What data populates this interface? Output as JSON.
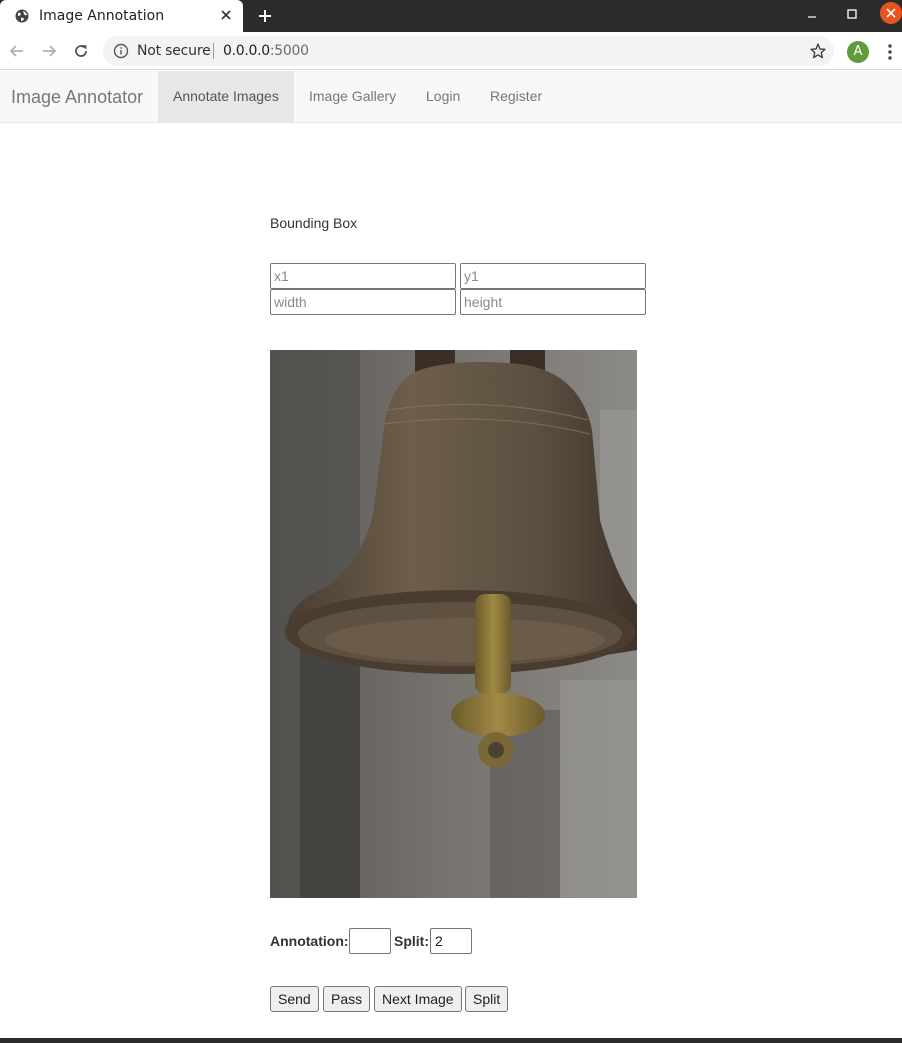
{
  "browser": {
    "tab_title": "Image Annotation",
    "security_label": "Not secure",
    "url_host": "0.0.0.0",
    "url_port": ":5000",
    "avatar_letter": "A",
    "icons": {
      "favicon": "globe-icon",
      "tab_close": "close-icon",
      "new_tab": "plus-icon",
      "back": "arrow-left-icon",
      "forward": "arrow-right-icon",
      "reload": "reload-icon",
      "info": "info-icon",
      "bookmark": "star-icon",
      "menu": "kebab-menu-icon"
    },
    "colors": {
      "titlebar": "#2b2b2b",
      "close_button": "#e95420",
      "avatar": "#5e9c3b"
    }
  },
  "navbar": {
    "brand": "Image Annotator",
    "items": [
      {
        "label": "Annotate Images",
        "active": true
      },
      {
        "label": "Image Gallery",
        "active": false
      },
      {
        "label": "Login",
        "active": false
      },
      {
        "label": "Register",
        "active": false
      }
    ]
  },
  "bbox": {
    "title": "Bounding Box",
    "x1_placeholder": "x1",
    "y1_placeholder": "y1",
    "width_placeholder": "width",
    "height_placeholder": "height"
  },
  "image": {
    "subject": "bronze temple bell"
  },
  "annotation": {
    "annotation_label": "Annotation:",
    "annotation_value": "",
    "split_label": "Split:",
    "split_value": "2"
  },
  "buttons": {
    "send": "Send",
    "pass": "Pass",
    "next_image": "Next Image",
    "split": "Split"
  }
}
